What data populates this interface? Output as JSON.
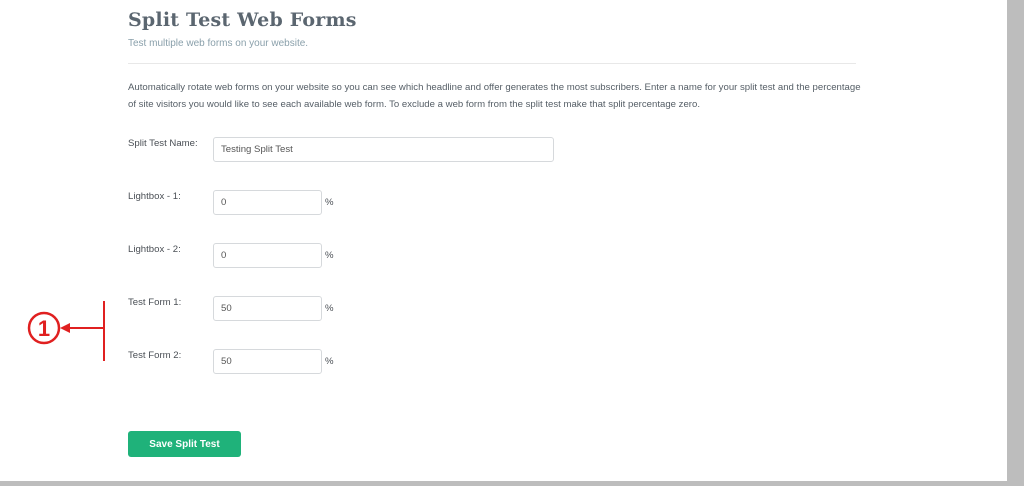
{
  "header": {
    "title": "Split Test Web Forms",
    "subtitle": "Test multiple web forms on your website."
  },
  "description": "Automatically rotate web forms on your website so you can see which headline and offer generates the most subscribers. Enter a name for your split test and the percentage of site visitors you would like to see each available web form. To exclude a web form from the split test make that split percentage zero.",
  "form": {
    "name_field": {
      "label": "Split Test Name:",
      "value": "Testing Split Test"
    },
    "percent_symbol": "%",
    "splits": [
      {
        "label": "Lightbox - 1:",
        "value": "0"
      },
      {
        "label": "Lightbox - 2:",
        "value": "0"
      },
      {
        "label": "Test Form 1:",
        "value": "50"
      },
      {
        "label": "Test Form 2:",
        "value": "50"
      }
    ],
    "save_label": "Save Split Test"
  },
  "annotation": {
    "marker": "1",
    "color": "#e02020"
  },
  "colors": {
    "accent": "#1fb27a",
    "title": "#5b6670",
    "frame": "#bdbdbd"
  }
}
